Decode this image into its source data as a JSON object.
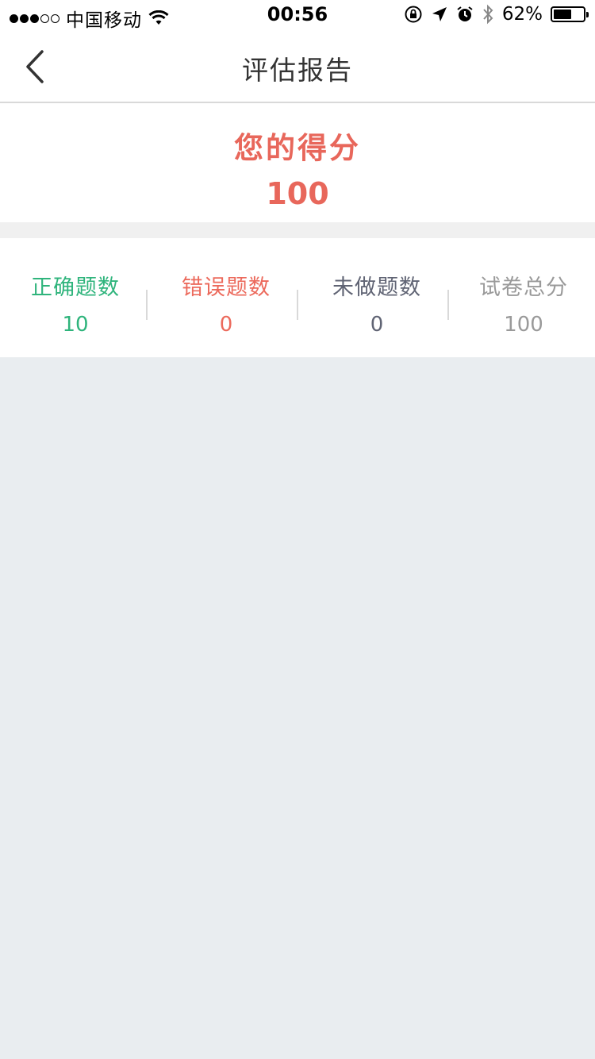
{
  "status_bar": {
    "carrier": "中国移动",
    "time": "00:56",
    "battery": "62%",
    "battery_level": 0.62,
    "icons": [
      "signal-dots",
      "wifi-icon",
      "rotation-lock-icon",
      "location-icon",
      "alarm-icon",
      "bluetooth-icon",
      "battery-icon"
    ]
  },
  "navbar": {
    "title": "评估报告",
    "back_icon": "chevron-left-icon"
  },
  "score": {
    "label": "您的得分",
    "value": "100"
  },
  "stats": [
    {
      "label": "正确题数",
      "value": "10"
    },
    {
      "label": "错误题数",
      "value": "0"
    },
    {
      "label": "未做题数",
      "value": "0"
    },
    {
      "label": "试卷总分",
      "value": "100"
    }
  ],
  "colors": {
    "score": "#e8675b",
    "correct": "#2fb47c",
    "wrong": "#ec6a5c",
    "undone": "#606474",
    "total": "#9a9a9a",
    "background": "#e9edf0"
  }
}
